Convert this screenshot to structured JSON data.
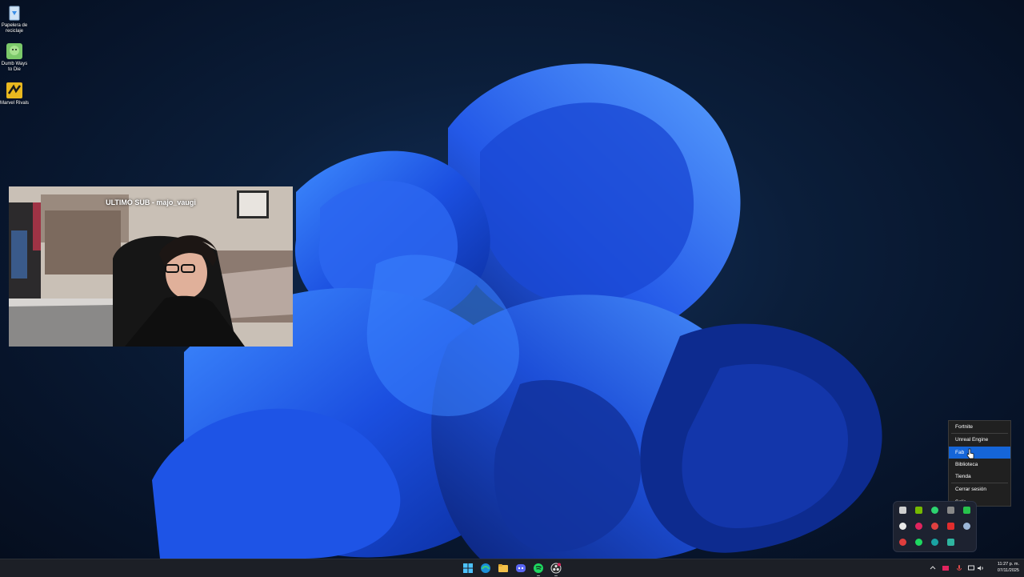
{
  "desktop": {
    "icons": [
      {
        "label": "Papelera de reciclaje",
        "icon": "recycle-bin-icon"
      },
      {
        "label": "Dumb Ways to Die",
        "icon": "game-icon"
      },
      {
        "label": "Marvel Rivals",
        "icon": "game-icon"
      }
    ]
  },
  "webcam": {
    "overlay_text": "ULTIMO SUB - majo_vaugi"
  },
  "context_menu": {
    "items": [
      {
        "label": "Fortnite"
      },
      {
        "label": "Unreal Engine"
      },
      {
        "label": "Fab"
      },
      {
        "label": "Biblioteca"
      },
      {
        "label": "Tienda"
      },
      {
        "label": "Cerrar sesión"
      },
      {
        "label": "Salir"
      }
    ],
    "selected": "Fab"
  },
  "tray_flyout": {
    "icons": [
      "tray-app-1",
      "nvidia-icon",
      "epic-games-icon",
      "tray-app-4",
      "tray-app-5",
      "tray-app-6",
      "tray-app-7",
      "tray-app-8",
      "tray-app-9",
      "steam-icon",
      "tray-app-11",
      "spotify-icon",
      "edge-icon",
      "tray-app-14"
    ]
  },
  "taskbar": {
    "apps": [
      "windows-start-icon",
      "edge-icon",
      "file-explorer-icon",
      "discord-icon",
      "spotify-icon",
      "obs-icon"
    ],
    "clock": {
      "time": "11:27 p. m.",
      "date": "07/11/2025"
    }
  },
  "colors": {
    "accent": "#1565d8",
    "menu_bg": "#202020",
    "taskbar_bg": "#1c1f26"
  }
}
